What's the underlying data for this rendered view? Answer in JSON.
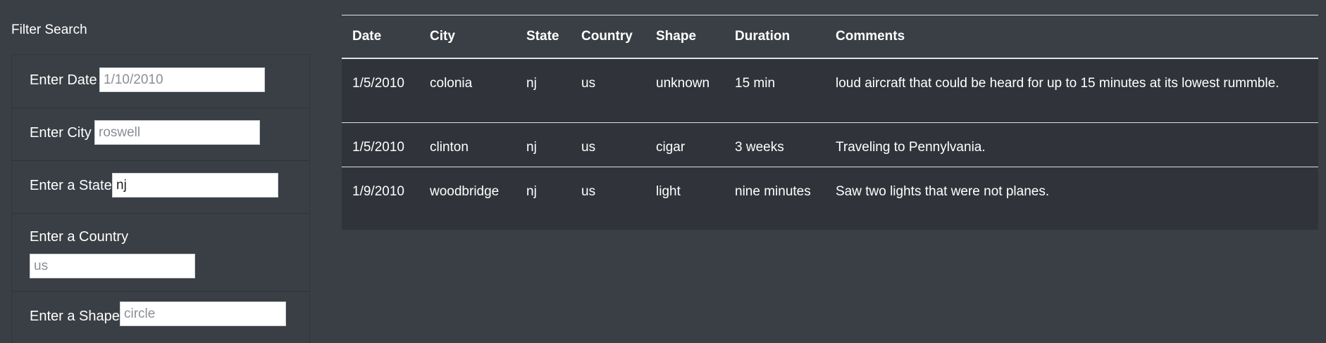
{
  "filter": {
    "title": "Filter Search",
    "date": {
      "label": "Enter Date",
      "placeholder": "1/10/2010",
      "value": ""
    },
    "city": {
      "label": "Enter City",
      "placeholder": "roswell",
      "value": ""
    },
    "state": {
      "label": "Enter a State",
      "placeholder": "",
      "value": "nj"
    },
    "country": {
      "label": "Enter a Country",
      "placeholder": "us",
      "value": ""
    },
    "shape": {
      "label": "Enter a Shape",
      "placeholder": "circle",
      "value": ""
    }
  },
  "table": {
    "columns": [
      "Date",
      "City",
      "State",
      "Country",
      "Shape",
      "Duration",
      "Comments"
    ],
    "rows": [
      [
        "1/5/2010",
        "colonia",
        "nj",
        "us",
        "unknown",
        "15 min",
        "loud aircraft that could be heard for up to 15 minutes at its lowest rummble."
      ],
      [
        "1/5/2010",
        "clinton",
        "nj",
        "us",
        "cigar",
        "3 weeks",
        "Traveling to Pennylvania."
      ],
      [
        "1/9/2010",
        "woodbridge",
        "nj",
        "us",
        "light",
        "nine minutes",
        "Saw two lights that were not planes."
      ]
    ]
  }
}
